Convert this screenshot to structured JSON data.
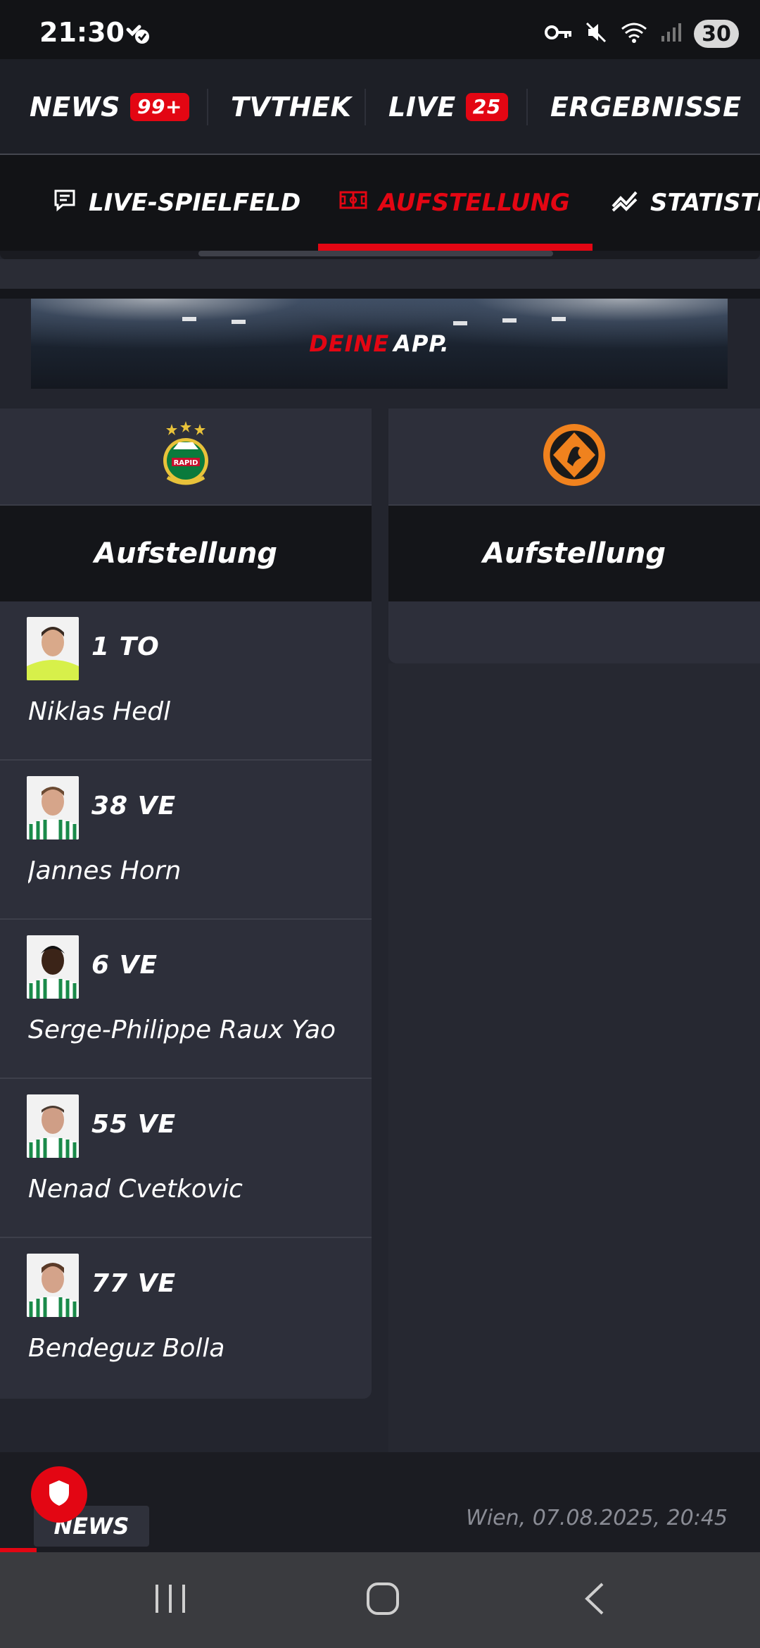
{
  "status_bar": {
    "time": "21:30",
    "battery": "30",
    "icons": [
      "check-badge-icon",
      "key-icon",
      "mute-icon",
      "wifi-icon",
      "signal-icon"
    ]
  },
  "top_nav": {
    "items": [
      {
        "label": "NEWS",
        "badge": "99+"
      },
      {
        "label": "TVTHEK"
      },
      {
        "label": "LIVE",
        "badge": "25"
      },
      {
        "label": "ERGEBNISSE"
      }
    ]
  },
  "sub_tabs": {
    "items": [
      {
        "label": "LIVE-SPIELFELD",
        "icon": "chat-icon"
      },
      {
        "label": "AUFSTELLUNG",
        "icon": "pitch-icon",
        "active": true
      },
      {
        "label": "STATISTI",
        "icon": "trend-icon"
      }
    ]
  },
  "banner": {
    "text_red": "DEINE",
    "text_white": "APP."
  },
  "home_team": {
    "logo_text": "RAPID",
    "lineup_title": "Aufstellung",
    "players": [
      {
        "number": "1 TO",
        "name": "Niklas Hedl"
      },
      {
        "number": "38  VE",
        "name": "Jannes Horn"
      },
      {
        "number": "6  VE",
        "name": "Serge-Philippe Raux Yao"
      },
      {
        "number": "55  VE",
        "name": "Nenad Cvetkovic"
      },
      {
        "number": "77  VE",
        "name": "Bendeguz Bolla"
      }
    ]
  },
  "away_team": {
    "lineup_title": "Aufstellung"
  },
  "bottom_news": {
    "tag": "NEWS",
    "date": "Wien, 07.08.2025, 20:45"
  },
  "colors": {
    "accent": "#e30613",
    "background": "#23252e",
    "header": "#121316"
  }
}
